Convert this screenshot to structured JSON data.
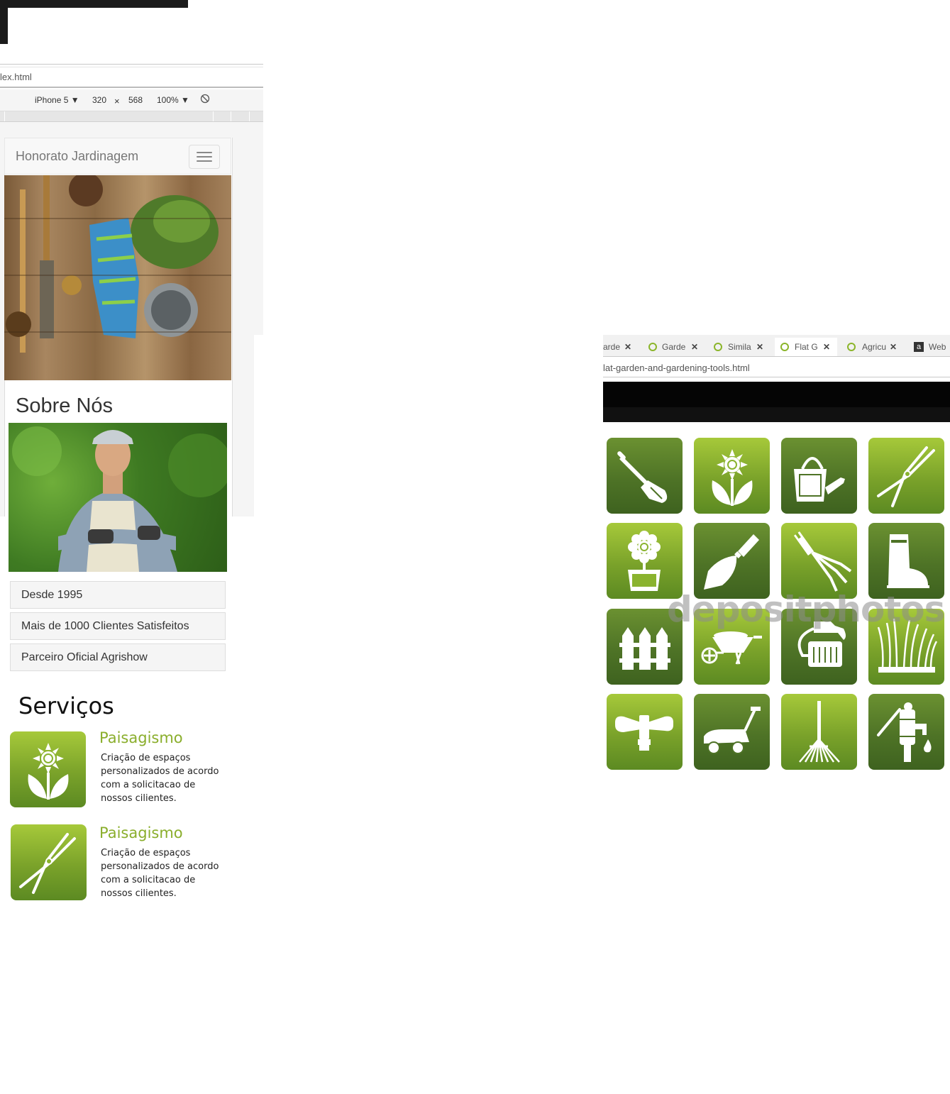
{
  "devtools": {
    "url": "lex.html",
    "device": "iPhone 5 ▼",
    "width": "320",
    "times": "×",
    "height": "568",
    "zoom": "100% ▼"
  },
  "site": {
    "brand": "Honorato Jardinagem",
    "about_title": "Sobre Nós",
    "about_items": [
      "Desde 1995",
      "Mais de 1000 Clientes Satisfeitos",
      "Parceiro Oficial Agrishow"
    ],
    "services_title": "Serviços",
    "services": [
      {
        "title": "Paisagismo",
        "text": "Criação de espaços personalizados de acordo com a solicitacao de nossos cilientes.",
        "icon": "sunflower-icon"
      },
      {
        "title": "Paisagismo",
        "text": "Criação de espaços personalizados de acordo com a solicitacao de nossos cilientes.",
        "icon": "hedge-shears-icon"
      }
    ]
  },
  "browser": {
    "tabs": [
      {
        "label": "arde",
        "active": false
      },
      {
        "label": "Garde",
        "active": false
      },
      {
        "label": "Simila",
        "active": false
      },
      {
        "label": "Flat G",
        "active": true
      },
      {
        "label": "Agricu",
        "active": false
      },
      {
        "label": "Web I",
        "active": false
      }
    ],
    "close_glyph": "✕",
    "url": "lat-garden-and-gardening-tools.html",
    "watermark": "depositphotos"
  },
  "icon_grid": [
    [
      "shovel-icon",
      "sunflower-icon",
      "watering-can-icon",
      "hedge-shears-icon"
    ],
    [
      "flower-pot-icon",
      "trowel-icon",
      "hand-fork-icon",
      "rubber-boot-icon"
    ],
    [
      "fence-icon",
      "wheelbarrow-icon",
      "hose-reel-icon",
      "grass-icon"
    ],
    [
      "sprinkler-icon",
      "lawn-mower-icon",
      "rake-icon",
      "water-pump-icon"
    ]
  ],
  "colors": {
    "tile_light": "#a6c93a",
    "tile_dark": "#4e7326",
    "service_title": "#8aae2c"
  }
}
